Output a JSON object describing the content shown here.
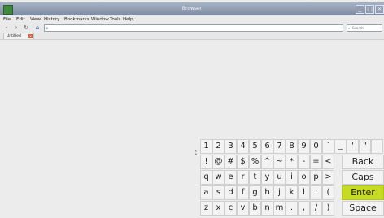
{
  "window": {
    "title": "Browser",
    "controls": [
      "_",
      "□",
      "×"
    ]
  },
  "menu": [
    "File",
    "Edit",
    "View",
    "History",
    "Bookmarks",
    "Window",
    "Tools",
    "Help"
  ],
  "nav": {
    "back": "‹",
    "forward": "›",
    "reload": "↻",
    "url": "",
    "url_icon": "⊕",
    "search_placeholder": "Search"
  },
  "tab": {
    "label": "Untitled",
    "close": "×"
  },
  "keyboard": {
    "rows": [
      [
        "1",
        "2",
        "3",
        "4",
        "5",
        "6",
        "7",
        "8",
        "9",
        "0",
        "`",
        "_",
        "'",
        "\"",
        "|"
      ],
      [
        "!",
        "@",
        "#",
        "$",
        "%",
        "^",
        "~",
        "*",
        "-",
        "=",
        "<",
        "Back"
      ],
      [
        "q",
        "w",
        "e",
        "r",
        "t",
        "y",
        "u",
        "i",
        "o",
        "p",
        ">",
        "Caps"
      ],
      [
        "a",
        "s",
        "d",
        "f",
        "g",
        "h",
        "j",
        "k",
        "l",
        ":",
        "(",
        "Enter"
      ],
      [
        "z",
        "x",
        "c",
        "v",
        "b",
        "n",
        "m",
        ".",
        ",",
        "/",
        ")",
        "Space"
      ]
    ]
  },
  "colors": {
    "enter_key": "#c6db23",
    "titlebar": "#8b98ae"
  }
}
